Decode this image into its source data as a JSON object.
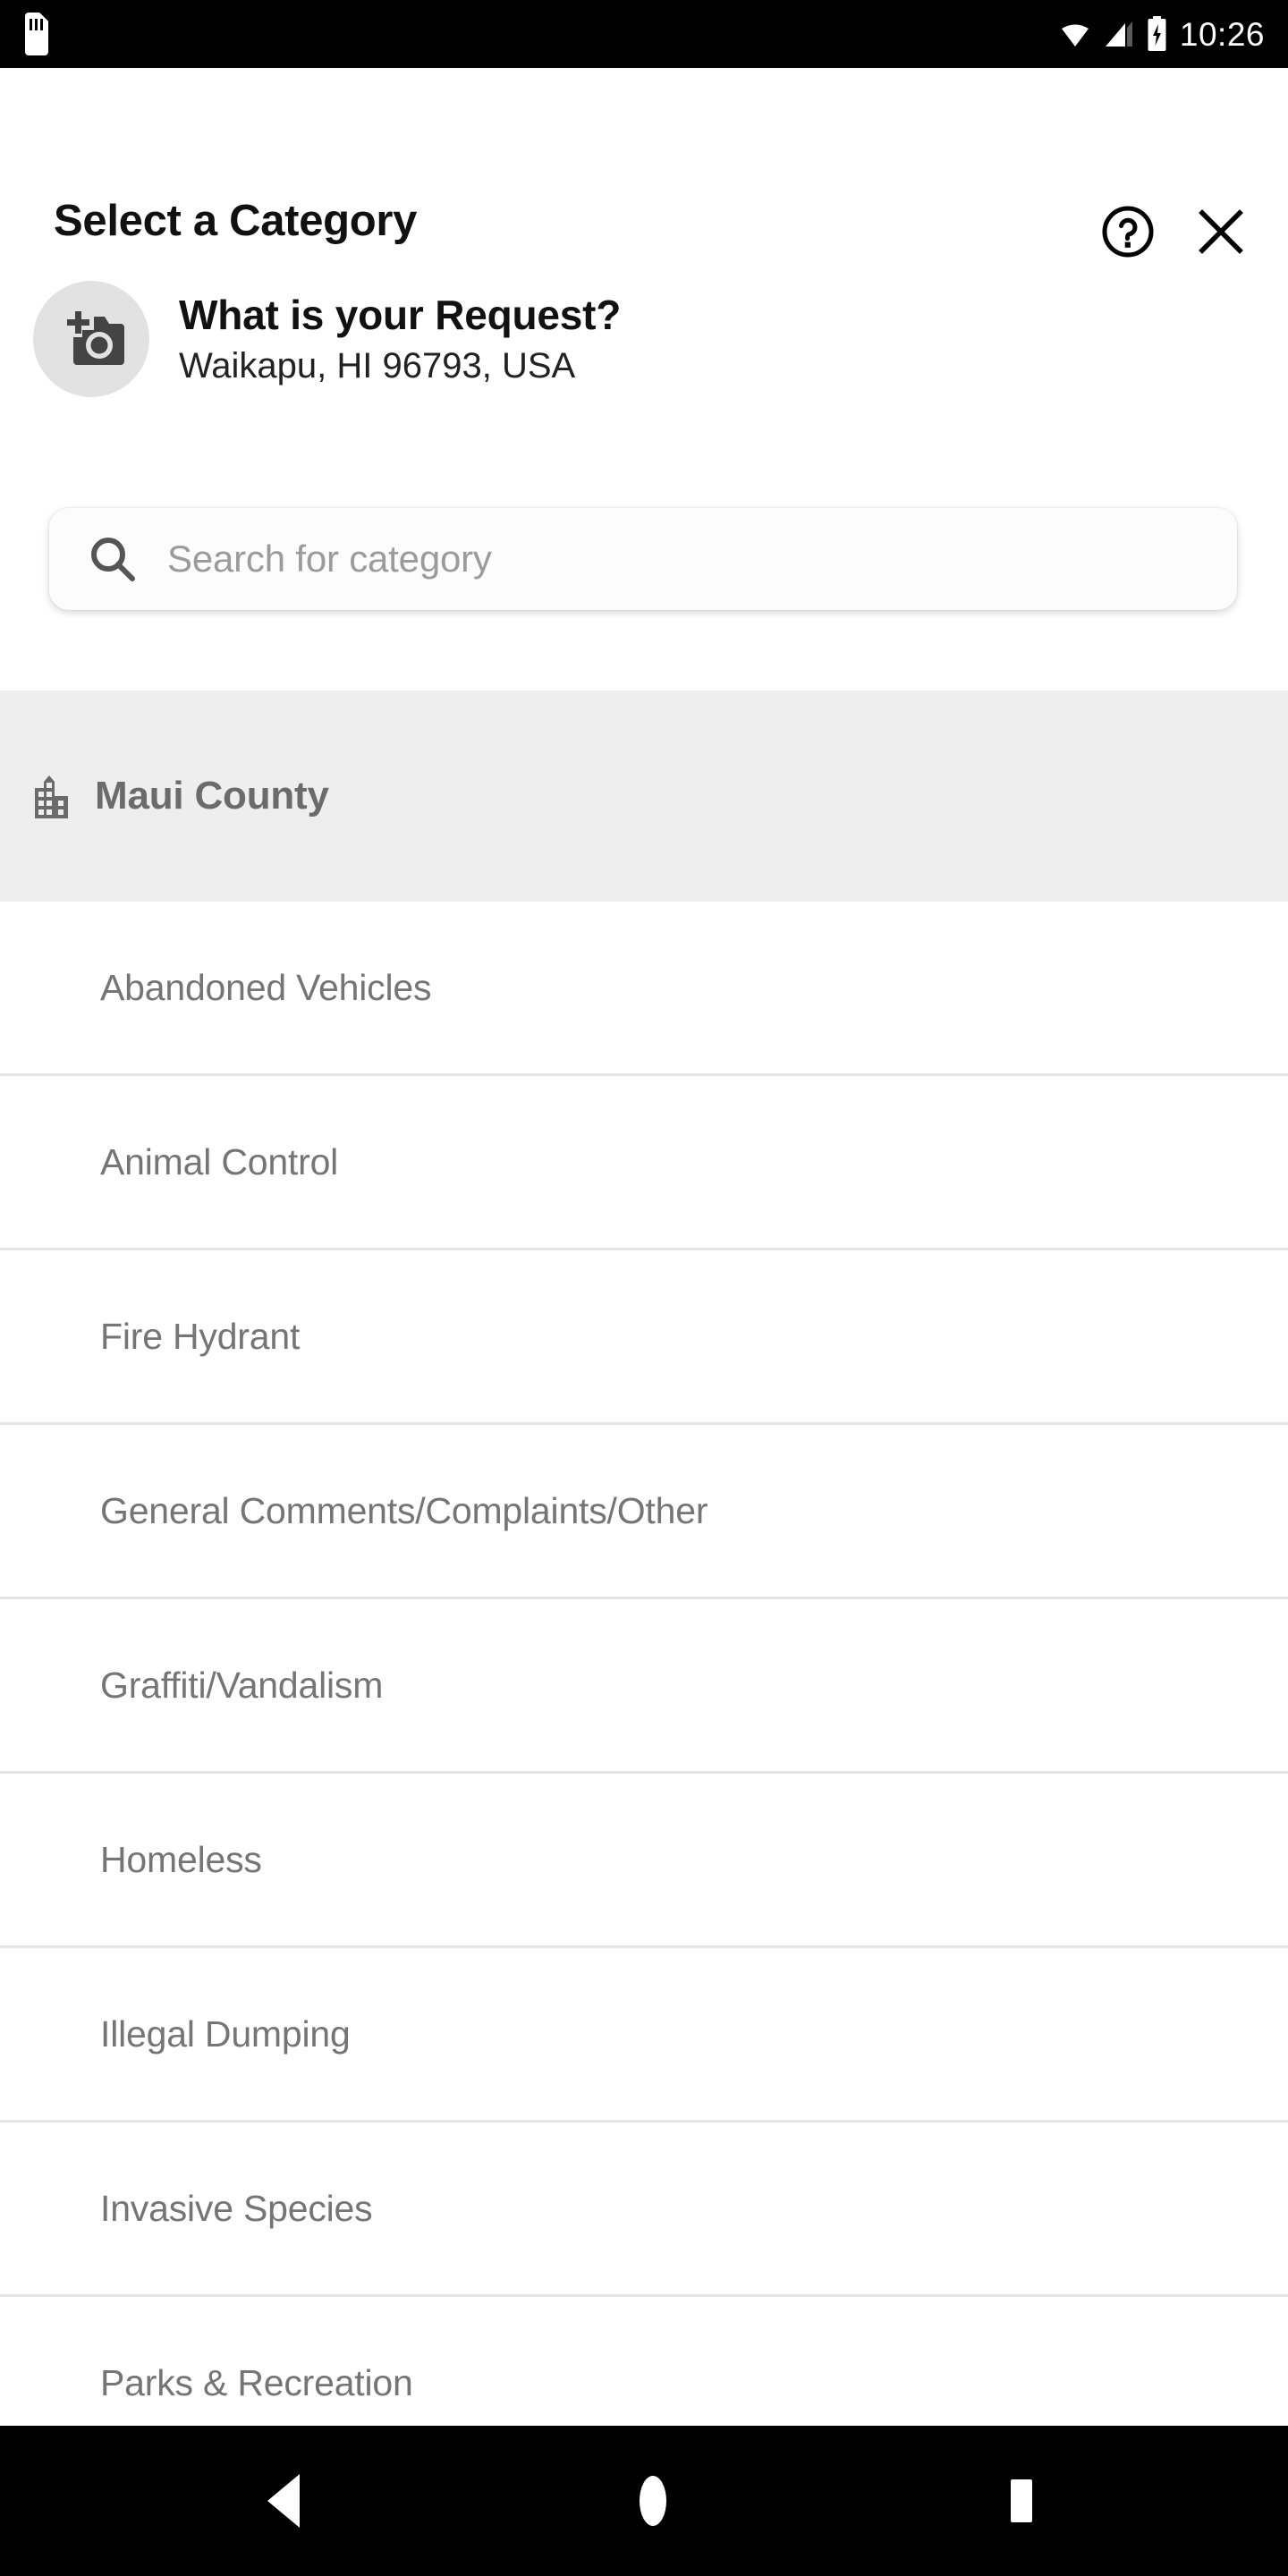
{
  "statusbar": {
    "time": "10:26",
    "icons": [
      "sd-card-icon",
      "wifi-icon",
      "cellular-signal-icon",
      "battery-charging-icon"
    ]
  },
  "header": {
    "title": "Select a Category",
    "help_icon": "help-circle-icon",
    "close_icon": "close-icon"
  },
  "request": {
    "photo_icon": "add-a-photo-icon",
    "title": "What is your Request?",
    "address": "Waikapu, HI 96793, USA"
  },
  "search": {
    "icon": "search-icon",
    "value": "",
    "placeholder": "Search for category"
  },
  "section": {
    "icon": "buildings-icon",
    "label": "Maui County"
  },
  "categories": [
    {
      "label": "Abandoned Vehicles"
    },
    {
      "label": "Animal Control"
    },
    {
      "label": "Fire Hydrant"
    },
    {
      "label": "General Comments/Complaints/Other"
    },
    {
      "label": "Graffiti/Vandalism"
    },
    {
      "label": "Homeless"
    },
    {
      "label": "Illegal Dumping"
    },
    {
      "label": "Invasive Species"
    },
    {
      "label": "Parks & Recreation"
    }
  ],
  "navbar": {
    "back": "back-triangle-icon",
    "home": "home-circle-icon",
    "recents": "recents-square-icon"
  },
  "colors": {
    "background": "#ffffff",
    "section_band": "#eeeeee",
    "row_text": "#757575",
    "divider": "#e4e4e4",
    "title_text": "#111111",
    "placeholder_text": "#9b9b9b",
    "statusbar": "#000000"
  }
}
